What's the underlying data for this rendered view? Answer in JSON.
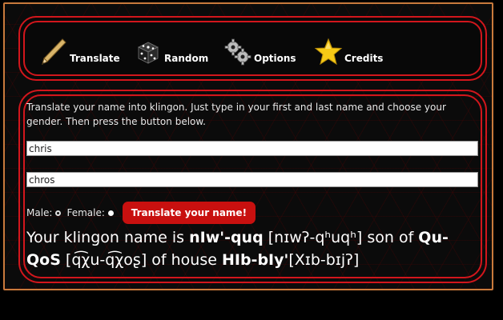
{
  "nav": {
    "items": [
      {
        "label": "Translate",
        "icon": "pencil-icon"
      },
      {
        "label": "Random",
        "icon": "dice-icon"
      },
      {
        "label": "Options",
        "icon": "gears-icon"
      },
      {
        "label": "Credits",
        "icon": "star-icon"
      }
    ]
  },
  "instructions": "Translate your name into klingon. Just type in your first and last name and choose your gender. Then press the button below.",
  "form": {
    "first_name": "chris",
    "last_name": "chros",
    "male_label": "Male:",
    "female_label": "Female:",
    "gender_selected": "female",
    "button_label": "Translate your name!"
  },
  "result": {
    "prefix": "Your klingon name is ",
    "first_klingon": "nIw'-quq",
    "first_ipa": " [nɪwʔ-qʰuqʰ]",
    "son_of": " son of ",
    "father_klingon": "Qu-QoS",
    "father_ipa": " [q͡χu-q͡χoʂ]",
    "of_house": " of house ",
    "house_klingon": "HIb-bIy'",
    "house_ipa": "[Xɪb-bɪjʔ]"
  },
  "colors": {
    "accent_red": "#d2161c",
    "button_red": "#c8100f",
    "outer_border": "#c97a3c",
    "background": "#000000"
  }
}
